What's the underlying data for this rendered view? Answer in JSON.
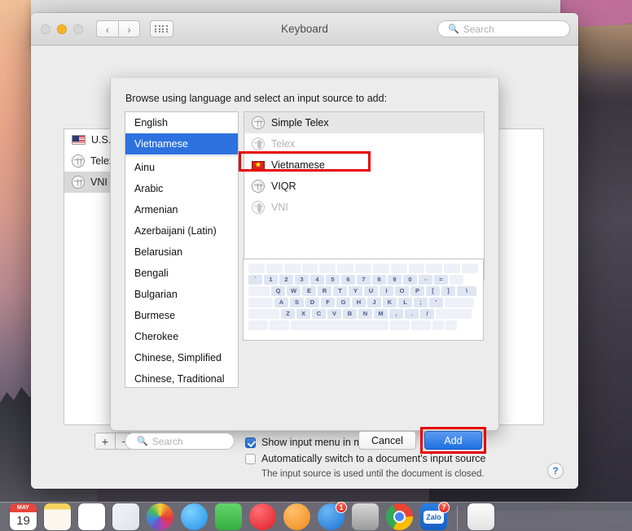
{
  "window": {
    "title": "Keyboard",
    "traffic_lights": [
      "close",
      "minimize",
      "zoom"
    ],
    "search": {
      "placeholder": "Search",
      "icon": "search-icon"
    },
    "nav": {
      "back": "‹",
      "forward": "›",
      "grid": "all-preferences-icon"
    },
    "help_label": "?"
  },
  "background_panel": {
    "input_sources": [
      {
        "name": "U.S.",
        "icon": "us-flag-icon",
        "selected": false
      },
      {
        "name": "Telex",
        "icon": "input-method-icon",
        "selected": false
      },
      {
        "name": "VNI",
        "icon": "input-method-icon",
        "selected": true
      }
    ],
    "add_label": "+",
    "remove_label": "−",
    "checkboxes": [
      {
        "label": "Show input menu in menu bar",
        "checked": true
      },
      {
        "label": "Automatically switch to a document's input source",
        "checked": false
      }
    ],
    "note": "The input source is used until the document is closed."
  },
  "sheet": {
    "prompt": "Browse using language and select an input source to add:",
    "languages": [
      {
        "label": "English",
        "selected": false,
        "separator_after": false
      },
      {
        "label": "Vietnamese",
        "selected": true,
        "separator_after": true
      },
      {
        "label": "Ainu",
        "selected": false,
        "separator_after": false
      },
      {
        "label": "Arabic",
        "selected": false,
        "separator_after": false
      },
      {
        "label": "Armenian",
        "selected": false,
        "separator_after": false
      },
      {
        "label": "Azerbaijani (Latin)",
        "selected": false,
        "separator_after": false
      },
      {
        "label": "Belarusian",
        "selected": false,
        "separator_after": false
      },
      {
        "label": "Bengali",
        "selected": false,
        "separator_after": false
      },
      {
        "label": "Bulgarian",
        "selected": false,
        "separator_after": false
      },
      {
        "label": "Burmese",
        "selected": false,
        "separator_after": false
      },
      {
        "label": "Cherokee",
        "selected": false,
        "separator_after": false
      },
      {
        "label": "Chinese, Simplified",
        "selected": false,
        "separator_after": false
      },
      {
        "label": "Chinese, Traditional",
        "selected": false,
        "separator_after": false
      }
    ],
    "input_sources": [
      {
        "label": "Simple Telex",
        "icon": "input-method-icon",
        "state": "highlighted-row",
        "dimmed": false,
        "flag": false
      },
      {
        "label": "Telex",
        "icon": "input-method-icon",
        "state": "installed",
        "dimmed": true,
        "flag": false
      },
      {
        "label": "Vietnamese",
        "icon": "vietnam-flag-icon",
        "state": "selected-annotated",
        "dimmed": false,
        "flag": true
      },
      {
        "label": "VIQR",
        "icon": "input-method-icon",
        "state": "normal",
        "dimmed": false,
        "flag": false
      },
      {
        "label": "VNI",
        "icon": "input-method-icon",
        "state": "installed",
        "dimmed": true,
        "flag": false
      }
    ],
    "keyboard_preview": {
      "rows": [
        [
          "",
          "",
          "",
          "",
          "",
          "",
          "",
          "",
          "",
          "",
          "",
          "",
          ""
        ],
        [
          "`",
          "1",
          "2",
          "3",
          "4",
          "5",
          "6",
          "7",
          "8",
          "9",
          "0",
          "-",
          "=",
          ""
        ],
        [
          "",
          "Q",
          "W",
          "E",
          "R",
          "T",
          "Y",
          "U",
          "I",
          "O",
          "P",
          "[",
          "]",
          "\\"
        ],
        [
          "",
          "A",
          "S",
          "D",
          "F",
          "G",
          "H",
          "J",
          "K",
          "L",
          ";",
          "'",
          ""
        ],
        [
          "",
          "Z",
          "X",
          "C",
          "V",
          "B",
          "N",
          "M",
          ",",
          ".",
          "/",
          ""
        ],
        [
          "",
          "",
          "",
          "",
          "",
          "",
          ""
        ]
      ]
    },
    "search": {
      "placeholder": "Search",
      "icon": "search-icon"
    },
    "cancel_label": "Cancel",
    "add_label": "Add",
    "annotations": {
      "color": "#e50000",
      "targets": [
        "vietnamese-input-source-row",
        "add-button"
      ]
    }
  },
  "dock": {
    "items": [
      {
        "name": "calendar",
        "badge": null
      },
      {
        "name": "notes",
        "badge": null
      },
      {
        "name": "reminders",
        "badge": null
      },
      {
        "name": "pages",
        "badge": null
      },
      {
        "name": "photos",
        "badge": null
      },
      {
        "name": "messages",
        "badge": null
      },
      {
        "name": "facetime",
        "badge": null
      },
      {
        "name": "itunes",
        "badge": null
      },
      {
        "name": "ibooks",
        "badge": null
      },
      {
        "name": "app-store",
        "badge": "1"
      },
      {
        "name": "system-preferences",
        "badge": null
      },
      {
        "name": "google-chrome",
        "badge": null
      },
      {
        "name": "zalo",
        "badge": "7"
      }
    ],
    "calendar_month": "MAY",
    "calendar_day": "19",
    "zalo_label": "Zalo"
  },
  "colors": {
    "selection_blue": "#2d72de",
    "annotation_red": "#e50000",
    "button_blue": "#1f70e2"
  }
}
